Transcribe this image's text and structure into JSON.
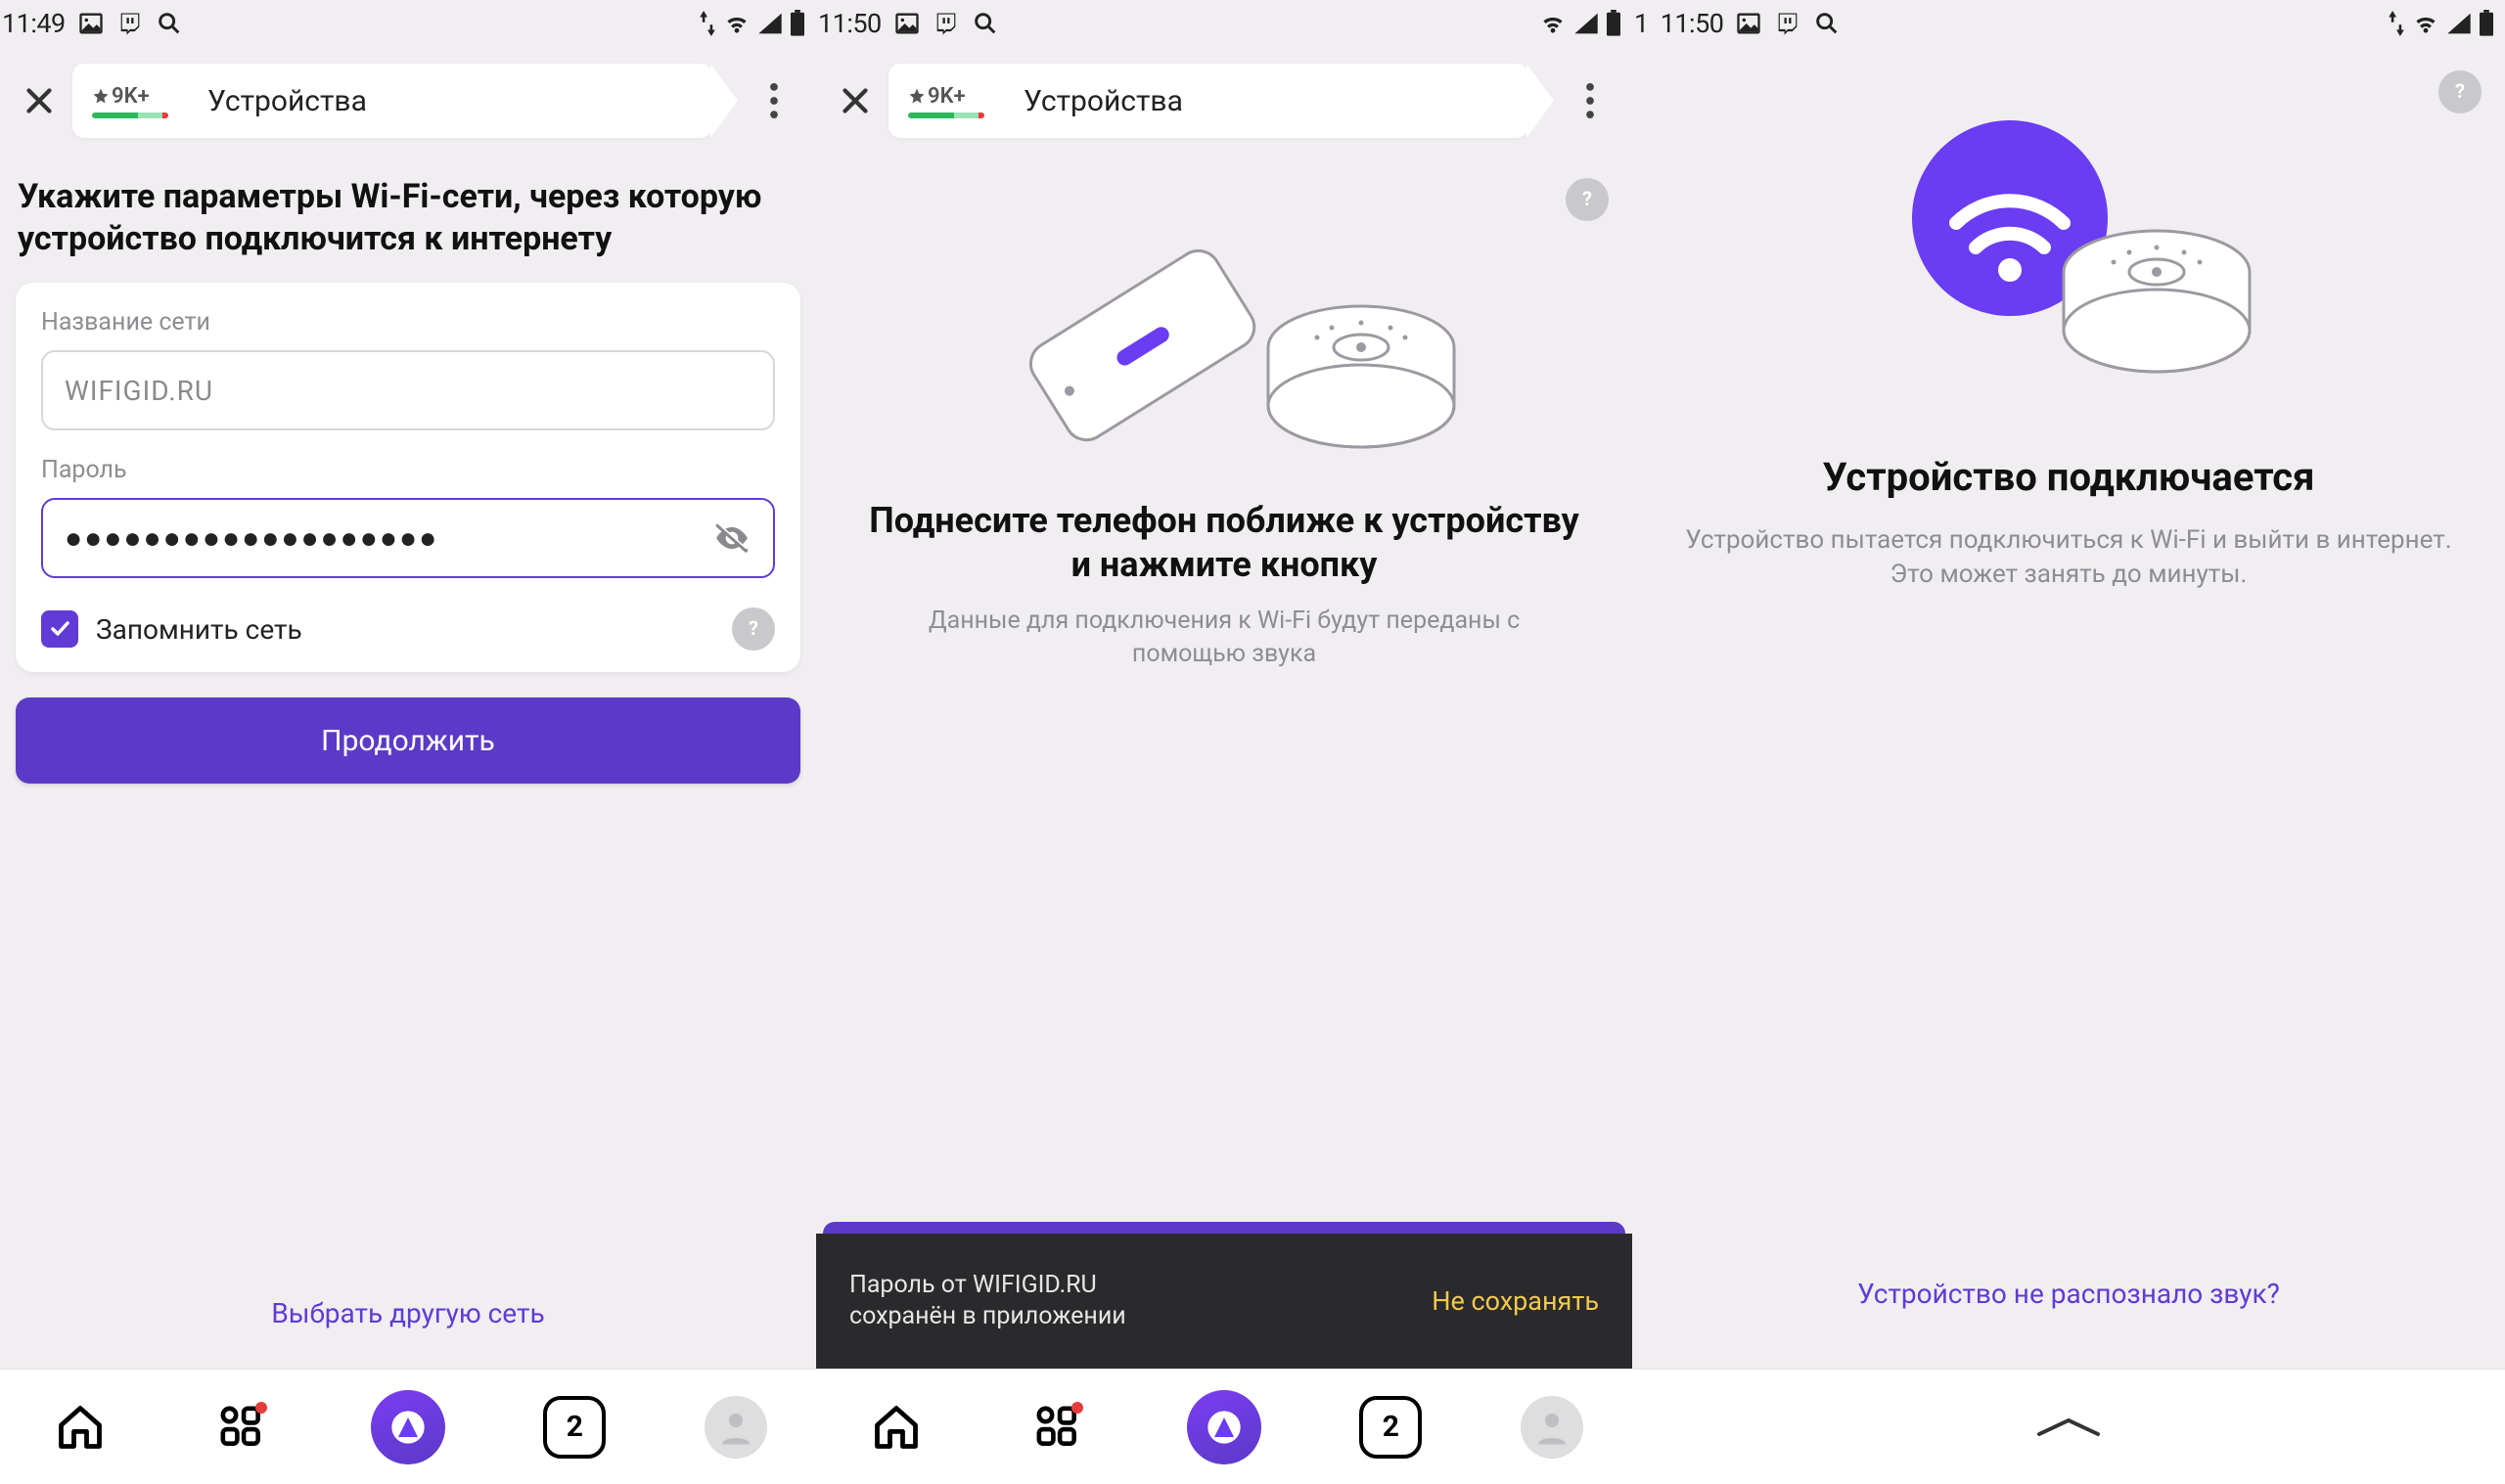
{
  "screen1": {
    "status": {
      "time": "11:49",
      "icons": [
        "image",
        "twitch",
        "search"
      ],
      "right": [
        "updown",
        "wifi",
        "signal",
        "battery"
      ]
    },
    "tab": {
      "rating": "9K+",
      "title": "Устройства"
    },
    "heading": "Укажите параметры Wi-Fi-сети, через которую устройство подключится к интернету",
    "network_label": "Название сети",
    "network_value": "WIFIGID.RU",
    "password_label": "Пароль",
    "password_value": "●●●●●●●●●●●●●●●●●●●",
    "remember_label": "Запомнить сеть",
    "continue_label": "Продолжить",
    "alt_link": "Выбрать другую сеть",
    "nav": {
      "count": "2"
    }
  },
  "screen2": {
    "status": {
      "time": "11:50",
      "icons": [
        "image",
        "twitch",
        "search"
      ],
      "right": [
        "wifi",
        "signal",
        "battery"
      ]
    },
    "tab": {
      "rating": "9K+",
      "title": "Устройства"
    },
    "title": "Поднесите телефон поближе к устройству и нажмите кнопку",
    "subtitle": "Данные для подключения к Wi-Fi будут переданы с помощью звука",
    "toast_text": "Пароль от WIFIGID.RU\nсохранён в приложении",
    "toast_action": "Не сохранять",
    "nav": {
      "count": "2"
    }
  },
  "screen3": {
    "status": {
      "time_prefix": "1",
      "time": "11:50",
      "icons": [
        "image",
        "twitch",
        "search"
      ],
      "right": [
        "updown",
        "wifi",
        "signal",
        "battery"
      ]
    },
    "title": "Устройство подключается",
    "subtitle": "Устройство пытается подключиться к Wi-Fi и выйти в интернет. Это может занять до минуты.",
    "alt_link": "Устройство не распознало звук?"
  }
}
